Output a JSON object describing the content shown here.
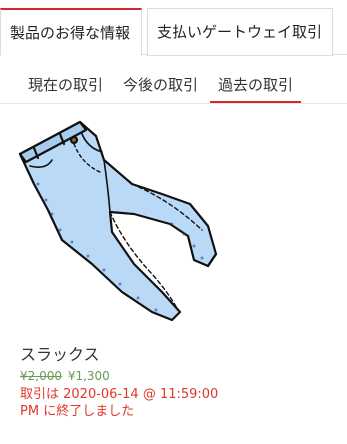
{
  "main_tabs": [
    {
      "label": "製品のお得な情報",
      "active": true
    },
    {
      "label": "支払いゲートウェイ取引",
      "active": false
    }
  ],
  "sub_tabs": [
    {
      "label": "現在の取引",
      "active": false
    },
    {
      "label": "今後の取引",
      "active": false
    },
    {
      "label": "過去の取引",
      "active": true
    }
  ],
  "colors": {
    "accent": "#d9262a",
    "price": "#6a9a55",
    "expired": "#e2372c",
    "jeans_fill": "#b9d9f7"
  },
  "product": {
    "image_icon": "jeans-icon",
    "name": "スラックス",
    "old_price": "¥2,000",
    "new_price": "¥1,300",
    "status": "取引は 2020-06-14 @ 11:59:00 PM に終了しました"
  }
}
